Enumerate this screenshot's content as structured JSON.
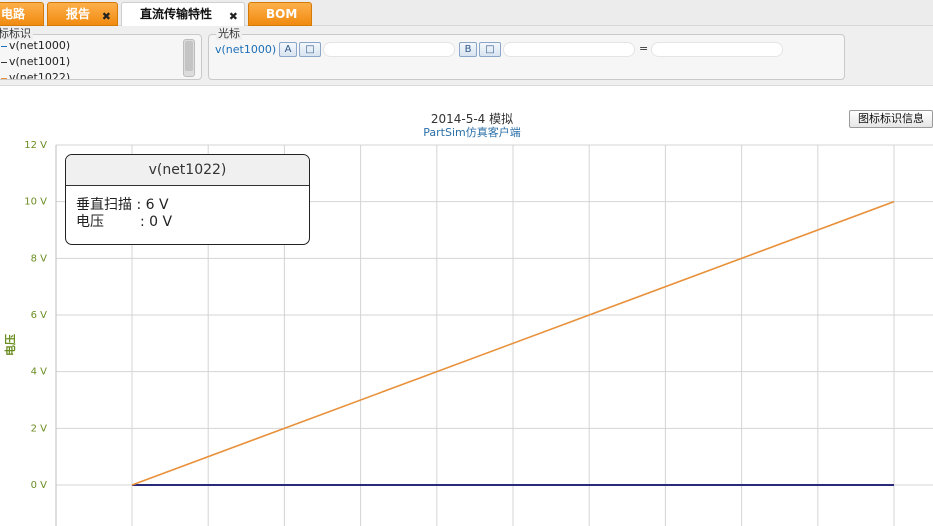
{
  "tabs": [
    {
      "label": "电路",
      "closable": false,
      "active": false
    },
    {
      "label": "报告",
      "closable": true,
      "active": false
    },
    {
      "label": "直流传输特性",
      "closable": true,
      "active": true
    },
    {
      "label": "BOM",
      "closable": false,
      "active": false
    }
  ],
  "legend_panel": {
    "title": "标标识",
    "items": [
      {
        "label": "v(net1000)",
        "color": "#1d6fb8"
      },
      {
        "label": "v(net1001)",
        "color": "#333333"
      },
      {
        "label": "v(net1022)",
        "color": "#e8913a"
      }
    ]
  },
  "cursor_panel": {
    "title": "光标",
    "net": "v(net1000)",
    "button_a": "A",
    "button_b": "B",
    "button_square": "□",
    "equals": "="
  },
  "legend_info_button": "图标标识信息",
  "tooltip": {
    "title": "v(net1022)",
    "rows": [
      {
        "label": "垂直扫描",
        "value": ": 6 V"
      },
      {
        "label": "电压",
        "value": ": 0 V"
      }
    ]
  },
  "chart_data": {
    "type": "line",
    "title": "2014-5-4 模拟",
    "subtitle": "PartSim仿真客户端",
    "ylabel": "电压",
    "xlabel": "",
    "ylim": [
      0,
      12
    ],
    "xlim": [
      0,
      10
    ],
    "yticks": [
      0,
      2,
      4,
      6,
      8,
      10,
      12
    ],
    "ytick_labels": [
      "0 V",
      "2 V",
      "4 V",
      "6 V",
      "8 V",
      "10 V",
      "12 V"
    ],
    "grid": true,
    "series": [
      {
        "name": "v(net1022)",
        "color": "#e8913a",
        "x": [
          0,
          10
        ],
        "y": [
          0,
          10
        ]
      },
      {
        "name": "v(net1000)",
        "color": "#2a2a7a",
        "x": [
          0,
          10
        ],
        "y": [
          0,
          0
        ]
      }
    ]
  }
}
